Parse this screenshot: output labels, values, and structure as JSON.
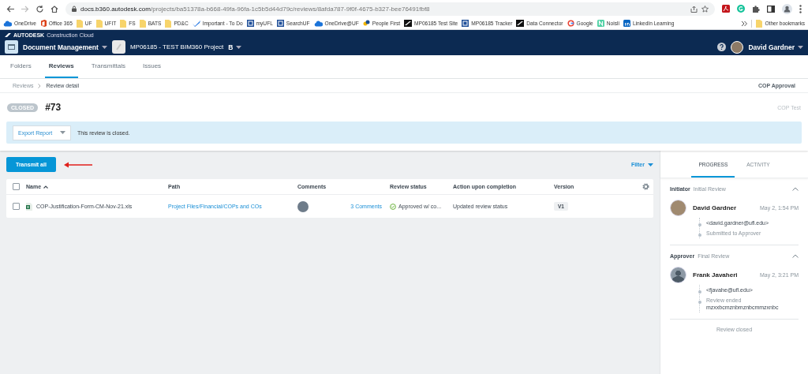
{
  "browser": {
    "url": {
      "host": "docs.b360.autodesk.com",
      "path": "/projects/ba51378a-b668-49fa-96fa-1c5b5d44d79c/reviews/8afda787-9f0f-4675-b327-bee76491fbf8"
    },
    "bookmarks": [
      {
        "label": "OneDrive",
        "kind": "cloud"
      },
      {
        "label": "Office 365",
        "kind": "office"
      },
      {
        "label": "UF",
        "kind": "folder"
      },
      {
        "label": "UFIT",
        "kind": "folder"
      },
      {
        "label": "FS",
        "kind": "folder"
      },
      {
        "label": "BATS",
        "kind": "folder"
      },
      {
        "label": "PD&C",
        "kind": "folder"
      },
      {
        "label": "Important - To Do",
        "kind": "todo"
      },
      {
        "label": "myUFL",
        "kind": "uf"
      },
      {
        "label": "SearchUF",
        "kind": "uf"
      },
      {
        "label": "OneDrive@UF",
        "kind": "cloud"
      },
      {
        "label": "People First",
        "kind": "people"
      },
      {
        "label": "MP06185 Test Site",
        "kind": "autodesk"
      },
      {
        "label": "MP06185 Tracker",
        "kind": "uf"
      },
      {
        "label": "Data Connector",
        "kind": "autodesk"
      },
      {
        "label": "Google",
        "kind": "google"
      },
      {
        "label": "Noisli",
        "kind": "noisli"
      },
      {
        "label": "LinkedIn Learning",
        "kind": "linkedin"
      }
    ],
    "other_bookmarks": "Other bookmarks"
  },
  "app": {
    "brand": "AUTODESK",
    "brand_sub": "Construction Cloud",
    "module": "Document Management",
    "project": "MP06185 - TEST BIM360 Project",
    "project_badge": "B",
    "user": "David Gardner"
  },
  "tabs": [
    {
      "label": "Folders",
      "selected": false
    },
    {
      "label": "Reviews",
      "selected": true
    },
    {
      "label": "Transmittals",
      "selected": false
    },
    {
      "label": "Issues",
      "selected": false
    }
  ],
  "breadcrumb": [
    "Reviews",
    "Review detail"
  ],
  "workflow": "COP Approval",
  "review": {
    "status": "CLOSED",
    "number": "#73",
    "name": "COP Test"
  },
  "banner": {
    "button": "Export Report",
    "message": "This review is closed."
  },
  "toolbar": {
    "transmit": "Transmit all",
    "annotation": {
      "kind": "arrow"
    },
    "filter": "Filter"
  },
  "table": {
    "select_all": {
      "checked": false
    },
    "columns": [
      {
        "label": "Name",
        "sorted": true
      },
      {
        "label": "Path",
        "sorted": false
      },
      {
        "label": "Comments",
        "sorted": false
      },
      {
        "label": "Review status",
        "sorted": false
      },
      {
        "label": "Action upon completion",
        "sorted": false
      },
      {
        "label": "Version",
        "sorted": false
      }
    ],
    "rows": [
      {
        "checked": false,
        "name": "COP-Justification-Form-CM-Nov-21.xls",
        "path": "Project Files/Financial/COPs and COs",
        "comments": "3 Comments",
        "review_status": "Approved w/ co...",
        "status_icon": {
          "kind": "approved"
        },
        "action": "Updated review status",
        "version": "V1"
      }
    ]
  },
  "panel": {
    "tabs": [
      {
        "label": "PROGRESS",
        "selected": true
      },
      {
        "label": "ACTIVITY",
        "selected": false
      }
    ],
    "sections": [
      {
        "role": "Initiator",
        "step": "Initial Review",
        "expanded": true,
        "name": "David Gardner",
        "avatar": {
          "kind": "photo"
        },
        "time": "May 2, 1:54 PM",
        "email": "<david.gardner@ufl.edu>",
        "events": [
          {
            "label": "Submitted to Approver"
          }
        ]
      },
      {
        "role": "Approver",
        "step": "Final Review",
        "expanded": true,
        "name": "Frank Javaheri",
        "avatar": {
          "kind": "silhouette"
        },
        "time": "May 2, 3:21 PM",
        "email": "<fjavahe@ufl.edu>",
        "events": [
          {
            "label": "Review ended",
            "comment": "mzxxbcmznbmznbcmmzxnbc"
          }
        ]
      }
    ],
    "footer": "Review closed"
  }
}
